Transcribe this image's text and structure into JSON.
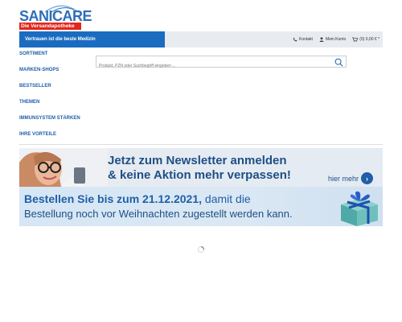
{
  "logo": {
    "wordmark": "SANICARE",
    "tagline": "Die Versandapotheke"
  },
  "topbar": {
    "claim": "Vertrauen ist die beste Medizin",
    "links": [
      {
        "icon": "phone-icon",
        "label": "Kontakt"
      },
      {
        "icon": "user-icon",
        "label": "Mein Konto"
      },
      {
        "icon": "cart-icon",
        "label": "(0) 0,00 € *"
      }
    ]
  },
  "nav": {
    "items": [
      "SORTIMENT",
      "MARKEN-SHOPS",
      "BESTSELLER",
      "THEMEN",
      "IMMUNSYSTEM STÄRKEN",
      "IHRE VORTEILE"
    ]
  },
  "search": {
    "placeholder": "Produkt, PZN oder Suchbegriff eingeben ...",
    "icon": "search-icon"
  },
  "banner": {
    "headline_1": "Jetzt zum Newsletter anmelden",
    "headline_2": "& keine Aktion mehr verpassen!",
    "more_label": "hier mehr",
    "order_line_prefix": "Bestellen Sie bis zum 21.12.2021,",
    "order_line_suffix": " damit die",
    "order_line_2": "Bestellung noch vor Weihnachten zugestellt werden kann."
  },
  "colors": {
    "brand_blue": "#1a6cc0",
    "logo_red": "#e3261b",
    "nav_blue": "#1f5fa8"
  }
}
